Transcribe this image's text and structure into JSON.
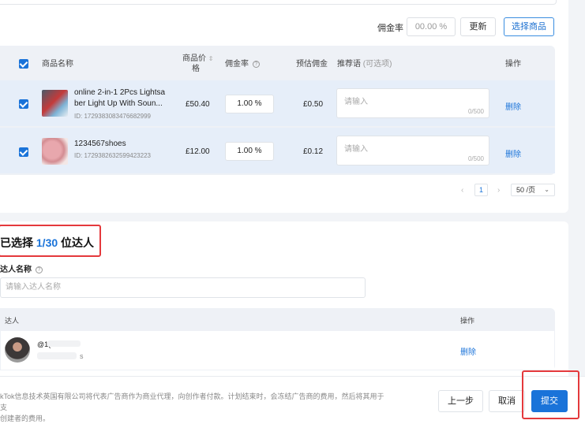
{
  "toolbar": {
    "rate_label": "佣金率",
    "rate_placeholder": "00.00 %",
    "update_label": "更新",
    "select_products_label": "选择商品"
  },
  "product_table": {
    "headers": {
      "name": "商品名称",
      "price_line1": "商品价",
      "price_line2": "格",
      "rate": "佣金率",
      "estimated": "预估佣金",
      "recommend": "推荐语",
      "recommend_optional": "(可选项)",
      "action": "操作"
    },
    "rows": [
      {
        "name_line1": "online 2-in-1 2Pcs Lightsa",
        "name_line2": "ber Light Up With Soun...",
        "id": "ID: 1729383083476682999",
        "price": "£50.40",
        "rate": "1.00 %",
        "estimated": "£0.50",
        "rec_placeholder": "请输入",
        "rec_count": "0/500",
        "delete": "删除",
        "checked": true
      },
      {
        "name_line1": "1234567shoes",
        "name_line2": "",
        "id": "ID: 1729382632599423223",
        "price": "£12.00",
        "rate": "1.00 %",
        "estimated": "£0.12",
        "rec_placeholder": "请输入",
        "rec_count": "0/500",
        "delete": "删除",
        "checked": true
      }
    ]
  },
  "pagination": {
    "prev": "‹",
    "current": "1",
    "next": "›",
    "page_size": "50 /页"
  },
  "selected": {
    "prefix": "已选择 ",
    "count": "1/30",
    "suffix": " 位达人"
  },
  "creator_search": {
    "label": "达人名称",
    "placeholder": "请输入达人名称"
  },
  "creator_table": {
    "headers": {
      "creator": "达人",
      "action": "操作"
    },
    "rows": [
      {
        "handle": "@1(",
        "handle_suffix": "s",
        "delete": "删除"
      }
    ]
  },
  "footer": {
    "note_line1": "kTok信息技术英国有限公司将代表广告商作为商业代理，向创作者付款。计划结束时，会冻结广告商的费用，然后将其用于支",
    "note_line2": "创建者的费用。",
    "prev_label": "上一步",
    "cancel_label": "取消",
    "submit_label": "提交"
  },
  "colors": {
    "accent": "#1a73d9",
    "highlight_box": "#e4393c"
  }
}
